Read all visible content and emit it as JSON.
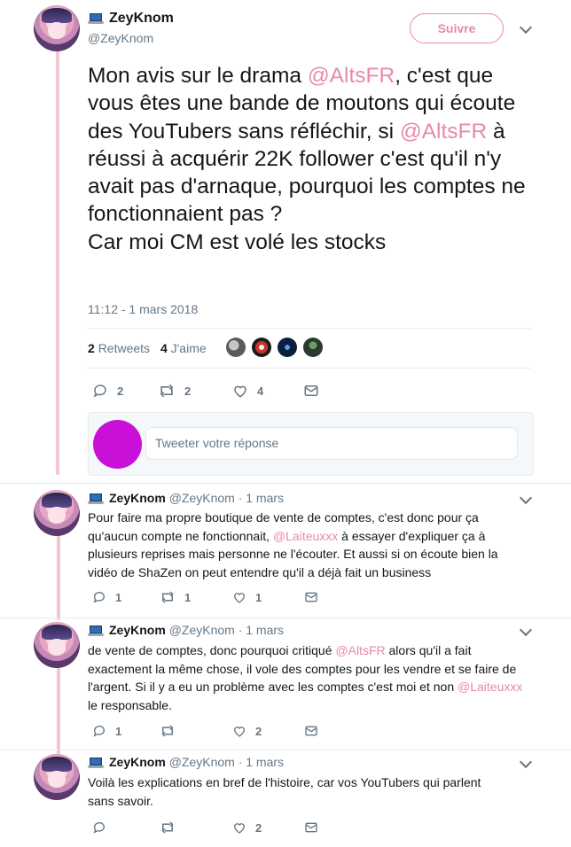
{
  "main_tweet": {
    "name": "ZeyKnom",
    "handle": "@ZeyKnom",
    "follow_label": "Suivre",
    "text_parts": [
      {
        "t": "Mon avis sur le drama ",
        "m": false
      },
      {
        "t": "@AltsFR",
        "m": true
      },
      {
        "t": ", c'est que vous êtes une bande de moutons qui écoute des YouTubers sans réfléchir, si ",
        "m": false
      },
      {
        "t": "@AltsFR",
        "m": true
      },
      {
        "t": " à réussi à acquérir 22K follower c'est qu'il n'y avait pas d'arnaque, pourquoi les comptes ne fonctionnaient pas ?\nCar moi CM est volé les stocks",
        "m": false
      }
    ],
    "timestamp": "11:12 - 1 mars 2018",
    "retweets_count": "2",
    "retweets_label": "Retweets",
    "likes_count": "4",
    "likes_label": "J'aime",
    "actions": {
      "reply": "2",
      "retweet": "2",
      "like": "4"
    }
  },
  "reply_composer": {
    "placeholder": "Tweeter votre réponse"
  },
  "replies": [
    {
      "name": "ZeyKnom",
      "handle": "@ZeyKnom",
      "date": "· 1 mars",
      "text_parts": [
        {
          "t": "Pour faire ma propre boutique de vente de comptes, c'est donc pour ça qu'aucun compte ne fonctionnait, ",
          "m": false
        },
        {
          "t": "@Laiteuxxx",
          "m": true
        },
        {
          "t": " à essayer d'expliquer ça à plusieurs reprises mais personne ne l'écouter. Et aussi si on écoute bien la vidéo de ShaZen on peut entendre qu'il a déjà fait un business",
          "m": false
        }
      ],
      "actions": {
        "reply": "1",
        "retweet": "1",
        "like": "1"
      }
    },
    {
      "name": "ZeyKnom",
      "handle": "@ZeyKnom",
      "date": "· 1 mars",
      "text_parts": [
        {
          "t": "de vente de comptes, donc pourquoi critiqué ",
          "m": false
        },
        {
          "t": "@AltsFR",
          "m": true
        },
        {
          "t": " alors qu'il a fait exactement la même chose, il vole des comptes pour les vendre et se faire de l'argent. Si il y a eu un problème avec les comptes c'est moi et non ",
          "m": false
        },
        {
          "t": "@Laiteuxxx",
          "m": true
        },
        {
          "t": " le responsable.",
          "m": false
        }
      ],
      "actions": {
        "reply": "1",
        "retweet": "",
        "like": "2"
      }
    },
    {
      "name": "ZeyKnom",
      "handle": "@ZeyKnom",
      "date": "· 1 mars",
      "text_parts": [
        {
          "t": "Voilà les explications en bref de l'histoire, car vos YouTubers qui parlent sans savoir.",
          "m": false
        }
      ],
      "actions": {
        "reply": "",
        "retweet": "",
        "like": "2"
      }
    }
  ],
  "colors": {
    "accent": "#e88aa6",
    "thread": "#f3c6d3",
    "composer_avatar": "#c810d8",
    "muted": "#657786"
  }
}
